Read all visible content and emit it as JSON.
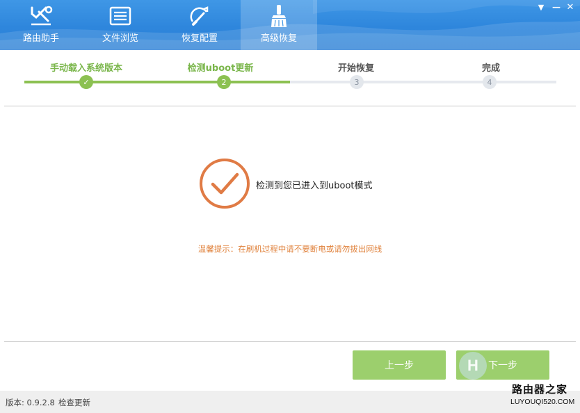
{
  "tabs": [
    {
      "label": "路由助手",
      "icon": "router-tools-icon",
      "active": false
    },
    {
      "label": "文件浏览",
      "icon": "file-list-icon",
      "active": false
    },
    {
      "label": "恢复配置",
      "icon": "restore-brush-icon",
      "active": false
    },
    {
      "label": "高级恢复",
      "icon": "broom-icon",
      "active": true
    }
  ],
  "window_controls": {
    "menu": "▼",
    "minimize": "—",
    "close": "✕"
  },
  "steps": [
    {
      "label": "手动载入系统版本",
      "marker": "✓",
      "status": "done"
    },
    {
      "label": "检测uboot更新",
      "marker": "2",
      "status": "done"
    },
    {
      "label": "开始恢复",
      "marker": "3",
      "status": "todo"
    },
    {
      "label": "完成",
      "marker": "4",
      "status": "todo"
    }
  ],
  "content": {
    "status_icon": "check-circle-icon",
    "status_text": "检测到您已进入到uboot模式",
    "tip": "温馨提示：在刷机过程中请不要断电或请勿拔出网线"
  },
  "buttons": {
    "prev": "上一步",
    "next": "下一步"
  },
  "footer": {
    "version": "版本: 0.9.2.8",
    "check_update": "检查更新"
  },
  "watermark": {
    "badge": "H",
    "title": "路由器之家",
    "url": "LUYOUQI520.COM"
  },
  "colors": {
    "header": "#2e86dc",
    "progress_done": "#8cc152",
    "button": "#9ccf6d",
    "check_circle": "#e07b45",
    "tip": "#e0823c"
  }
}
